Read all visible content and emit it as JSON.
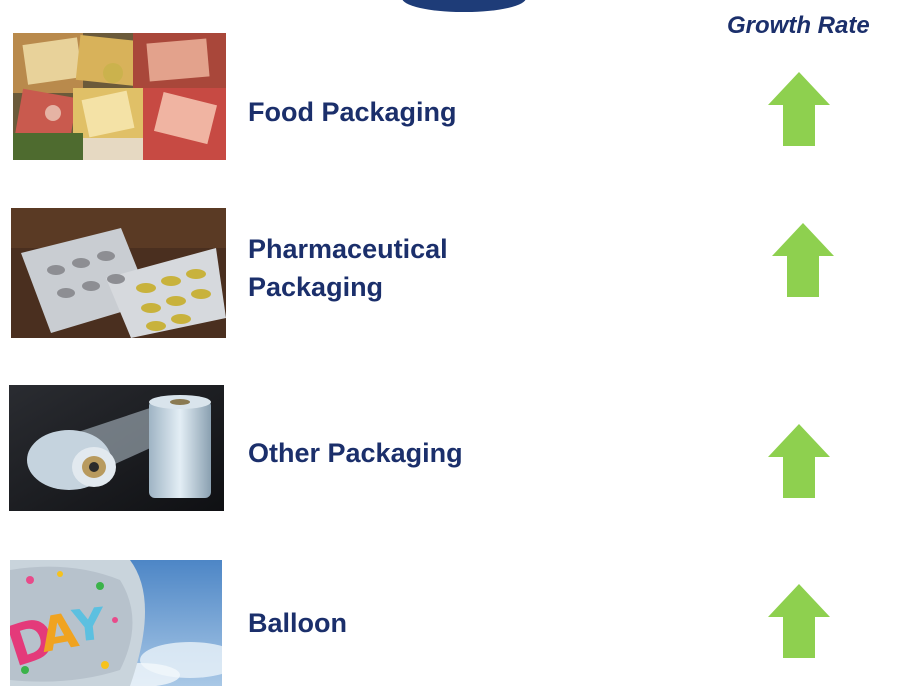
{
  "header": {
    "column_title": "Growth Rate"
  },
  "rows": [
    {
      "label_lines": [
        "Food Packaging"
      ],
      "trend": "up",
      "trend_icon": "up-arrow-icon",
      "color": "#8ed04f"
    },
    {
      "label_lines": [
        "Pharmaceutical",
        "Packaging"
      ],
      "trend": "up",
      "trend_icon": "up-arrow-icon",
      "color": "#8ed04f"
    },
    {
      "label_lines": [
        "Other Packaging"
      ],
      "trend": "up",
      "trend_icon": "up-arrow-icon",
      "color": "#8ed04f"
    },
    {
      "label_lines": [
        "Balloon"
      ],
      "trend": "up",
      "trend_icon": "up-arrow-icon",
      "color": "#8ed04f"
    }
  ],
  "colors": {
    "text": "#1b2f6b",
    "accent": "#1e3c78",
    "arrow": "#8ed04f"
  }
}
